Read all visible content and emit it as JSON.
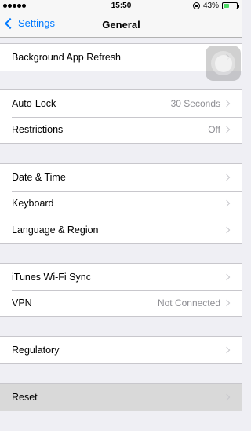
{
  "status_bar": {
    "time": "15:50",
    "battery_percent": "43%",
    "battery_level": 0.43,
    "signal_dots": 5
  },
  "nav": {
    "back_label": "Settings",
    "title": "General"
  },
  "groups": [
    {
      "rows": [
        {
          "label": "Background App Refresh",
          "value": ""
        }
      ]
    },
    {
      "rows": [
        {
          "label": "Auto-Lock",
          "value": "30 Seconds"
        },
        {
          "label": "Restrictions",
          "value": "Off"
        }
      ]
    },
    {
      "rows": [
        {
          "label": "Date & Time",
          "value": ""
        },
        {
          "label": "Keyboard",
          "value": ""
        },
        {
          "label": "Language & Region",
          "value": ""
        }
      ]
    },
    {
      "rows": [
        {
          "label": "iTunes Wi-Fi Sync",
          "value": ""
        },
        {
          "label": "VPN",
          "value": "Not Connected"
        }
      ]
    },
    {
      "rows": [
        {
          "label": "Regulatory",
          "value": ""
        }
      ]
    },
    {
      "rows": [
        {
          "label": "Reset",
          "value": ""
        }
      ]
    }
  ],
  "colors": {
    "accent": "#007aff",
    "background": "#efeff4",
    "secondary_text": "#8e8e93",
    "battery": "#4cd964"
  }
}
